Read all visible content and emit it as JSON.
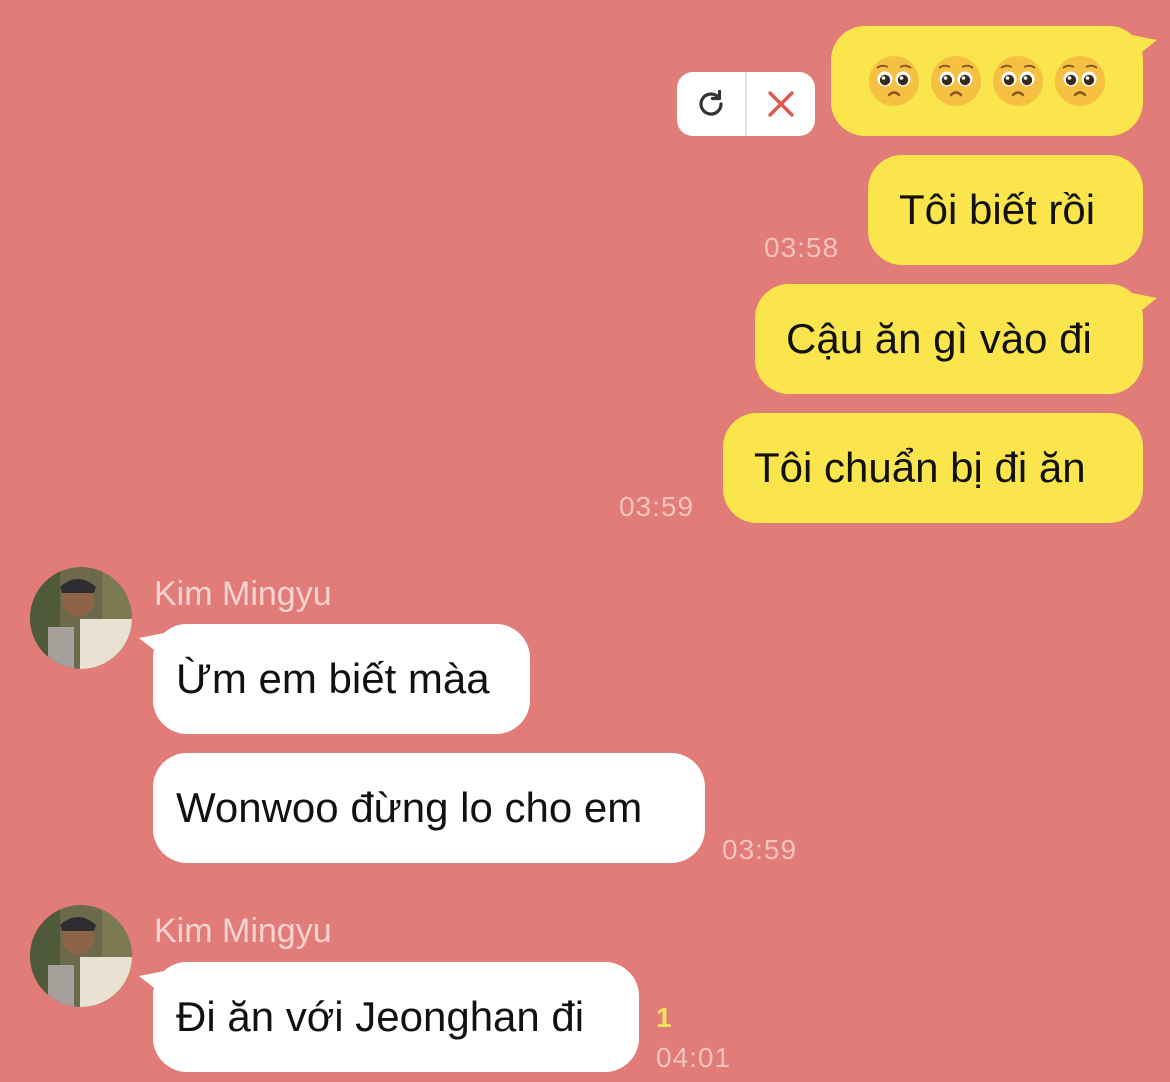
{
  "colors": {
    "background": "#E27C78",
    "outgoing_bubble": "#FAE64C",
    "incoming_bubble": "#FFFFFF",
    "timestamp": "#F4C2BF",
    "unread": "#F5E15B",
    "retry_close": "#E0584E"
  },
  "failed_message": {
    "emojis": [
      "pleading-face",
      "pleading-face",
      "pleading-face",
      "pleading-face"
    ],
    "retry_icon": "refresh-icon",
    "delete_icon": "close-icon"
  },
  "outgoing": [
    {
      "text": "Tôi biết rồi",
      "time": "03:58"
    },
    {
      "text": "Cậu ăn gì vào đi"
    },
    {
      "text": "Tôi chuẩn bị đi ăn",
      "time": "03:59"
    }
  ],
  "incoming_group_1": {
    "sender": "Kim Mingyu",
    "messages": [
      {
        "text": "Ừm em biết màa"
      },
      {
        "text": "Wonwoo đừng lo cho em",
        "time": "03:59"
      }
    ]
  },
  "incoming_group_2": {
    "sender": "Kim Mingyu",
    "messages": [
      {
        "text": "Đi ăn với Jeonghan đi",
        "unread": "1",
        "time": "04:01"
      }
    ]
  }
}
